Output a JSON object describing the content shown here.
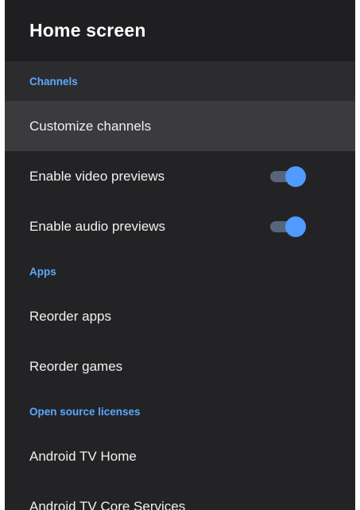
{
  "header": {
    "title": "Home screen"
  },
  "sections": [
    {
      "title": "Channels",
      "items": [
        {
          "label": "Customize channels"
        },
        {
          "label": "Enable video previews",
          "toggle": true
        },
        {
          "label": "Enable audio previews",
          "toggle": true
        }
      ]
    },
    {
      "title": "Apps",
      "items": [
        {
          "label": "Reorder apps"
        },
        {
          "label": "Reorder games"
        }
      ]
    },
    {
      "title": "Open source licenses",
      "items": [
        {
          "label": "Android TV Home"
        },
        {
          "label": "Android TV Core Services"
        }
      ]
    }
  ],
  "colors": {
    "accent": "#4f9bff",
    "section_header": "#5aa9ff",
    "panel_bg": "#232325",
    "focused_row_bg": "#3b3b3d"
  }
}
